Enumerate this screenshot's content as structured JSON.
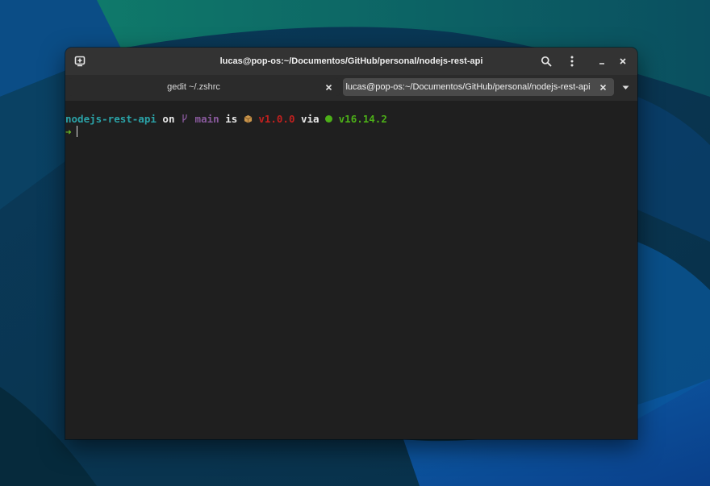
{
  "window": {
    "title": "lucas@pop-os:~/Documentos/GitHub/personal/nodejs-rest-api"
  },
  "tabs": [
    {
      "label": "gedit ~/.zshrc",
      "active": false
    },
    {
      "label": "lucas@pop-os:~/Documentos/GitHub/personal/nodejs-rest-api",
      "active": true
    }
  ],
  "icons": {
    "new_tab": "new-tab-icon",
    "search": "search-icon",
    "menu": "kebab-menu-icon",
    "minimize": "minimize-icon",
    "close": "close-icon",
    "tab_close": "close-icon",
    "tab_list": "chevron-down-icon",
    "branch": "git-branch-icon",
    "package": "package-icon",
    "node": "node-dot-icon"
  },
  "prompt": {
    "dir": "nodejs-rest-api",
    "on": "on",
    "branch": "main",
    "is": "is",
    "package_version": "v1.0.0",
    "via": "via",
    "node_version": "v16.14.2",
    "arrow": "➜"
  },
  "colors": {
    "dir": "#2aa3a8",
    "text": "#e8e8e8",
    "branch": "#8a5a9e",
    "package": "#c0201f",
    "node": "#4caf18",
    "arrow": "#6cc02a",
    "package_icon": "#c9954b"
  }
}
